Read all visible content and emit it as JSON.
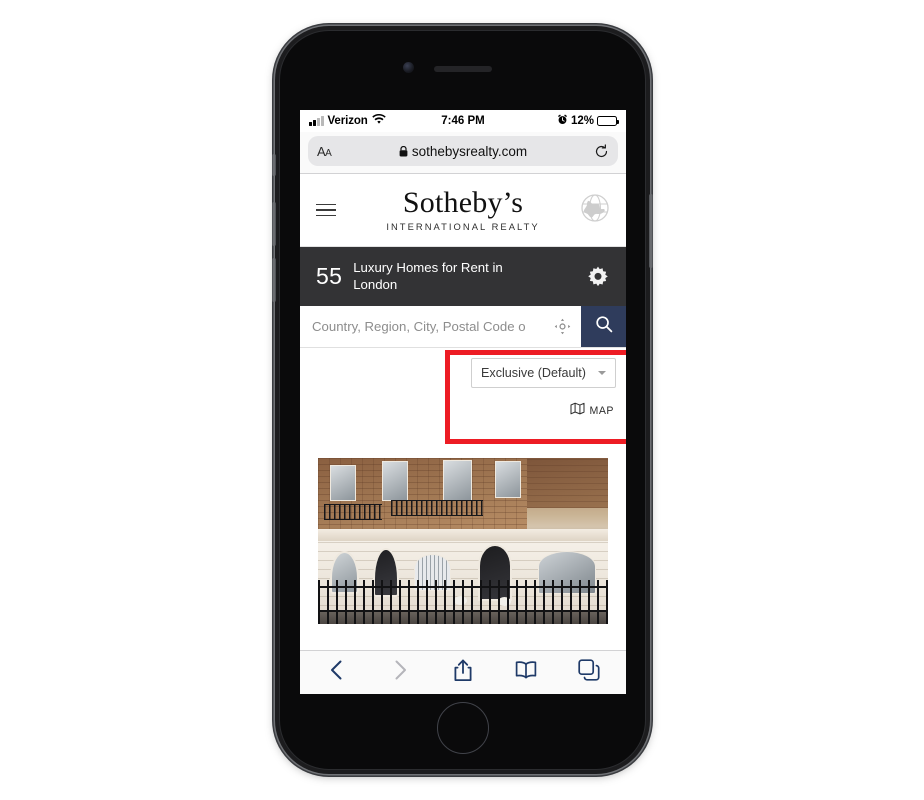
{
  "status_bar": {
    "carrier": "Verizon",
    "time": "7:46 PM",
    "battery_percent": "12%",
    "battery_level": 12,
    "signal_icon": "signal-bars-icon",
    "wifi_icon": "wifi-icon",
    "alarm_icon": "alarm-clock-icon",
    "battery_color": "#e8453c"
  },
  "browser": {
    "text_size_label_large": "A",
    "text_size_label_small": "A",
    "url": "sothebysrealty.com",
    "lock_icon": "lock-icon",
    "reload_icon": "reload-icon",
    "toolbar": {
      "back_icon": "chevron-left-icon",
      "forward_icon": "chevron-right-icon",
      "share_icon": "share-icon",
      "bookmarks_icon": "book-icon",
      "tabs_icon": "tabs-icon",
      "active_color": "#1f3a68",
      "disabled_color": "#b5b5ba"
    }
  },
  "site_header": {
    "menu_icon": "hamburger-menu-icon",
    "brand_name": "Sotheby’s",
    "brand_tagline": "INTERNATIONAL REALTY",
    "globe_icon": "globe-icon"
  },
  "results_bar": {
    "count": "55",
    "title": "Luxury Homes for Rent in London",
    "settings_icon": "gear-icon",
    "background_color": "#333335"
  },
  "search": {
    "placeholder": "Country, Region, City, Postal Code o",
    "value": "",
    "geolocate_icon": "crosshair-icon",
    "submit_icon": "search-icon",
    "submit_color": "#2f3c5c"
  },
  "filters": {
    "sort_selected": "Exclusive (Default)",
    "sort_options": [
      "Exclusive (Default)"
    ],
    "caret_icon": "chevron-down-icon",
    "map_label": "MAP",
    "map_icon": "map-icon",
    "highlight_color": "#ed1c24"
  },
  "listing": {
    "image_alt": "london-townhouse-photo"
  }
}
